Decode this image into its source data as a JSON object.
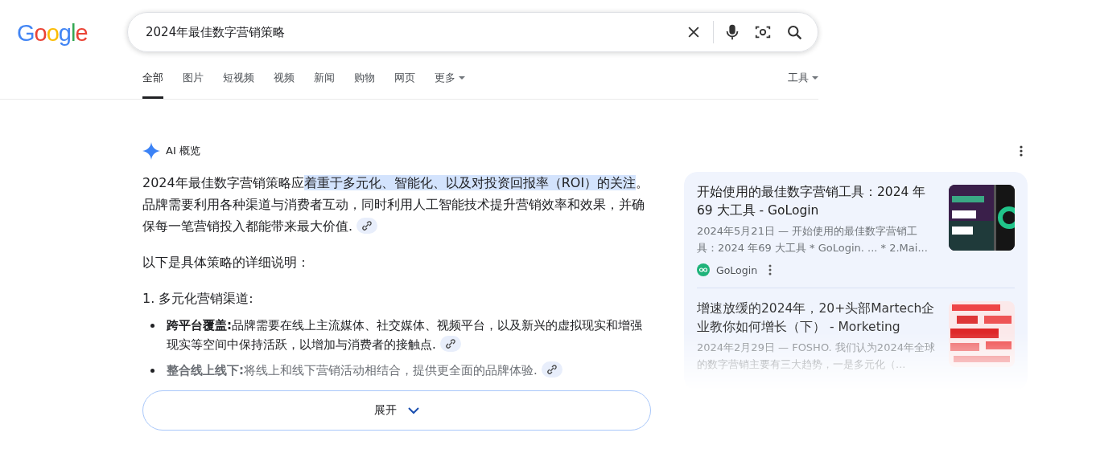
{
  "logo": "Google",
  "search": {
    "value": "2024年最佳数字营销策略"
  },
  "tabs": [
    {
      "label": "全部",
      "selected": true,
      "kind": "tab"
    },
    {
      "label": "图片",
      "selected": false,
      "kind": "tab"
    },
    {
      "label": "短视频",
      "selected": false,
      "kind": "tab"
    },
    {
      "label": "视频",
      "selected": false,
      "kind": "tab"
    },
    {
      "label": "新闻",
      "selected": false,
      "kind": "tab"
    },
    {
      "label": "购物",
      "selected": false,
      "kind": "tab"
    },
    {
      "label": "网页",
      "selected": false,
      "kind": "tab"
    },
    {
      "label": "更多",
      "selected": false,
      "kind": "menu"
    }
  ],
  "tools": "工具",
  "ai_overview": {
    "title": "AI 概览",
    "intro": [
      {
        "text": "2024年最佳数字营销策略应",
        "highlighted": false
      },
      {
        "text": "着重于多元化、智能化、以及对投资回报率（ROI）的关注",
        "highlighted": true
      },
      {
        "text": "。品牌需要利用各种渠道与消费者互动，同时利用人工智能技术提升营销效率和效果，并确保每一笔营销投入都能带来最大价值.",
        "highlighted": false
      }
    ],
    "lead": "以下是具体策略的详细说明：",
    "heading": "1. 多元化营销渠道:",
    "bullets": [
      {
        "text": "**跨平台覆盖:**品牌需要在线上主流媒体、社交媒体、视频平台，以及新兴的虚拟现实和增强现实等空间中保持活跃，以增加与消费者的接触点.",
        "faded": false
      },
      {
        "text": "**整合线上线下:**将线上和线下营销活动相结合，提供更全面的品牌体验.",
        "faded": true
      }
    ],
    "expand": "展开"
  },
  "sources": [
    {
      "title": "开始使用的最佳数字营销工具：2024 年 69 大工具 - GoLogin",
      "snippet": "2024年5月21日 — 开始使用的最佳数字营销工具：2024 年69 大工具 * GoLogin. ... * 2.Mai...",
      "site": "GoLogin",
      "faded": false
    },
    {
      "title": "增速放缓的2024年，20+头部Martech企业教你如何增长（下） - Morketing",
      "snippet": "2024年2月29日 — FOSHO. 我们认为2024年全球的数字营销主要有三大趋势，一是多元化（...",
      "faded": true
    }
  ]
}
